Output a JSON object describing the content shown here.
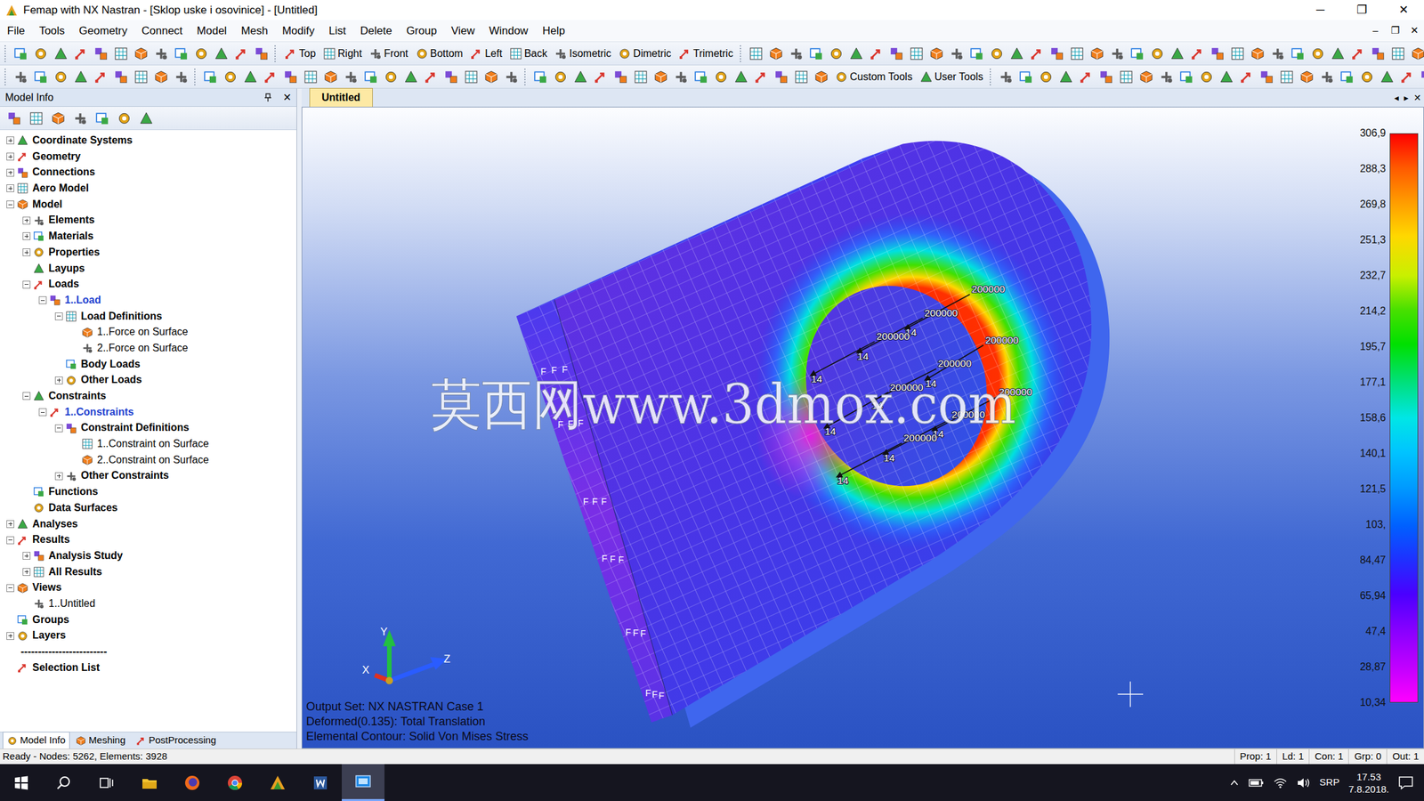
{
  "window": {
    "title": "Femap with NX Nastran - [Sklop uske i osovinice] - [Untitled]",
    "controls": [
      "─",
      "❐",
      "✕"
    ]
  },
  "menu": {
    "items": [
      "File",
      "Tools",
      "Geometry",
      "Connect",
      "Model",
      "Mesh",
      "Modify",
      "List",
      "Delete",
      "Group",
      "View",
      "Window",
      "Help"
    ],
    "mdi_controls": [
      "–",
      "❐",
      "✕"
    ]
  },
  "toolbar1": {
    "view_buttons": [
      "Top",
      "Right",
      "Front",
      "Bottom",
      "Left",
      "Back",
      "Isometric",
      "Dimetric",
      "Trimetric"
    ]
  },
  "toolbar2": {
    "tool_buttons": [
      "Custom Tools",
      "User Tools"
    ]
  },
  "model_info": {
    "title": "Model Info",
    "close": "✕"
  },
  "tree": {
    "items": [
      {
        "label": "Coordinate Systems",
        "depth": 0,
        "kind": "branch",
        "expanded": false,
        "active": false
      },
      {
        "label": "Geometry",
        "depth": 0,
        "kind": "branch",
        "expanded": false,
        "active": false
      },
      {
        "label": "Connections",
        "depth": 0,
        "kind": "branch",
        "expanded": false,
        "active": false
      },
      {
        "label": "Aero Model",
        "depth": 0,
        "kind": "branch",
        "expanded": false,
        "active": false
      },
      {
        "label": "Model",
        "depth": 0,
        "kind": "branch",
        "expanded": true,
        "active": false
      },
      {
        "label": "Elements",
        "depth": 1,
        "kind": "branch",
        "expanded": false,
        "active": false
      },
      {
        "label": "Materials",
        "depth": 1,
        "kind": "branch",
        "expanded": false,
        "active": false
      },
      {
        "label": "Properties",
        "depth": 1,
        "kind": "branch",
        "expanded": false,
        "active": false
      },
      {
        "label": "Layups",
        "depth": 1,
        "kind": "leaf",
        "expanded": false,
        "active": false
      },
      {
        "label": "Loads",
        "depth": 1,
        "kind": "branch",
        "expanded": true,
        "active": false
      },
      {
        "label": "1..Load",
        "depth": 2,
        "kind": "branch",
        "expanded": true,
        "active": true
      },
      {
        "label": "Load Definitions",
        "depth": 3,
        "kind": "branch",
        "expanded": true,
        "active": false
      },
      {
        "label": "1..Force on Surface",
        "depth": 4,
        "kind": "entry",
        "expanded": false,
        "active": false
      },
      {
        "label": "2..Force on Surface",
        "depth": 4,
        "kind": "entry",
        "expanded": false,
        "active": false
      },
      {
        "label": "Body Loads",
        "depth": 3,
        "kind": "leaf",
        "expanded": false,
        "active": false
      },
      {
        "label": "Other Loads",
        "depth": 3,
        "kind": "branch",
        "expanded": false,
        "active": false
      },
      {
        "label": "Constraints",
        "depth": 1,
        "kind": "branch",
        "expanded": true,
        "active": false
      },
      {
        "label": "1..Constraints",
        "depth": 2,
        "kind": "branch",
        "expanded": true,
        "active": true
      },
      {
        "label": "Constraint Definitions",
        "depth": 3,
        "kind": "branch",
        "expanded": true,
        "active": false
      },
      {
        "label": "1..Constraint on Surface",
        "depth": 4,
        "kind": "entry",
        "expanded": false,
        "active": false
      },
      {
        "label": "2..Constraint on Surface",
        "depth": 4,
        "kind": "entry",
        "expanded": false,
        "active": false
      },
      {
        "label": "Other Constraints",
        "depth": 3,
        "kind": "branch",
        "expanded": false,
        "active": false
      },
      {
        "label": "Functions",
        "depth": 1,
        "kind": "leaf",
        "expanded": false,
        "active": false
      },
      {
        "label": "Data Surfaces",
        "depth": 1,
        "kind": "leaf",
        "expanded": false,
        "active": false
      },
      {
        "label": "Analyses",
        "depth": 0,
        "kind": "branch",
        "expanded": false,
        "active": false
      },
      {
        "label": "Results",
        "depth": 0,
        "kind": "branch",
        "expanded": true,
        "active": false
      },
      {
        "label": "Analysis Study",
        "depth": 1,
        "kind": "branch",
        "expanded": false,
        "active": false
      },
      {
        "label": "All Results",
        "depth": 1,
        "kind": "branch",
        "expanded": false,
        "active": false
      },
      {
        "label": "Views",
        "depth": 0,
        "kind": "branch",
        "expanded": true,
        "active": false
      },
      {
        "label": "1..Untitled",
        "depth": 1,
        "kind": "entry",
        "expanded": false,
        "active": false
      },
      {
        "label": "Groups",
        "depth": 0,
        "kind": "leaf",
        "expanded": false,
        "active": false
      },
      {
        "label": "Layers",
        "depth": 0,
        "kind": "branch",
        "expanded": false,
        "active": false
      },
      {
        "label": "-------------------------",
        "depth": 0,
        "kind": "separator",
        "expanded": false,
        "active": false
      },
      {
        "label": "Selection List",
        "depth": 0,
        "kind": "leaf",
        "expanded": false,
        "active": false
      }
    ]
  },
  "panel_tabs": [
    {
      "label": "Model Info",
      "selected": true
    },
    {
      "label": "Meshing",
      "selected": false
    },
    {
      "label": "PostProcessing",
      "selected": false
    }
  ],
  "document_tab": {
    "label": "Untitled",
    "selected": true
  },
  "document_nav": [
    "◂",
    "▸",
    "✕"
  ],
  "viewport": {
    "watermark": "莫西网www.3dmox.com",
    "loads": [
      {
        "magnitude": "200000",
        "label": "14"
      },
      {
        "magnitude": "200000",
        "label": "14"
      },
      {
        "magnitude": "200000",
        "label": "14"
      },
      {
        "magnitude": "200000",
        "label": "14"
      },
      {
        "magnitude": "200000",
        "label": "14"
      },
      {
        "magnitude": "200000",
        "label": "14"
      },
      {
        "magnitude": "200000",
        "label": "14"
      },
      {
        "magnitude": "200000",
        "label": "14"
      },
      {
        "magnitude": "200000",
        "label": "14"
      }
    ],
    "constraint_marks": [
      "F",
      "F",
      "F",
      "F",
      "F",
      "F",
      "F",
      "F",
      "F",
      "F",
      "F",
      "F",
      "F",
      "F",
      "F",
      "F",
      "F",
      "F"
    ],
    "axes": {
      "x": "X",
      "y": "Y",
      "z": "Z"
    },
    "info_lines": [
      "Output Set: NX NASTRAN Case 1",
      "Deformed(0.135): Total Translation",
      "Elemental Contour: Solid Von Mises Stress"
    ]
  },
  "legend": {
    "values": [
      "306,9",
      "288,3",
      "269,8",
      "251,3",
      "232,7",
      "214,2",
      "195,7",
      "177,1",
      "158,6",
      "140,1",
      "121,5",
      "103,",
      "84,47",
      "65,94",
      "47,4",
      "28,87",
      "10,34"
    ]
  },
  "status_bar": {
    "message": "Ready - Nodes: 5262, Elements: 3928",
    "fields": [
      "Prop: 1",
      "Ld: 1",
      "Con: 1",
      "Grp: 0",
      "Out: 1"
    ]
  },
  "taskbar": {
    "apps": [
      {
        "kind": "explorer",
        "selected": false
      },
      {
        "kind": "firefox",
        "selected": false
      },
      {
        "kind": "chrome",
        "selected": false
      },
      {
        "kind": "femap",
        "selected": false
      },
      {
        "kind": "word",
        "selected": false
      },
      {
        "kind": "window",
        "selected": true
      }
    ],
    "language": "SRP",
    "time": "17.53",
    "date": "7.8.2018."
  }
}
